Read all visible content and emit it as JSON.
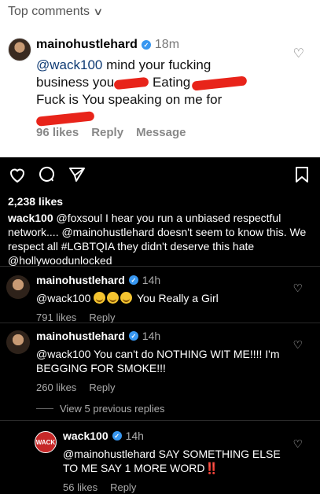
{
  "top_card": {
    "header": "Top comments",
    "username": "mainohustlehard",
    "time": "18m",
    "line1_mention": "@wack100",
    "line1_rest": " mind your fucking",
    "line2_start": "business you",
    "line2_mid": " Eating",
    "line3": "Fuck is You speaking on me for",
    "likes": "96 likes",
    "reply": "Reply",
    "message": "Message"
  },
  "post": {
    "likes": "2,238 likes",
    "caption_user": "wack100",
    "caption_text": " @foxsoul I hear you run a unbiased respectful network.... @mainohustlehard doesn't seem to know this. We respect all #LGBTQIA they didn't deserve this hate @hollywoodunlocked"
  },
  "comments": [
    {
      "username": "mainohustlehard",
      "time": "14h",
      "text_start": "@wack100",
      "text_end": "You Really a Girl",
      "likes": "791 likes",
      "reply": "Reply"
    },
    {
      "username": "mainohustlehard",
      "time": "14h",
      "text": "@wack100 You can't do NOTHING WIT ME!!!! I'm BEGGING FOR SMOKE!!!",
      "likes": "260 likes",
      "reply": "Reply"
    }
  ],
  "view_previous": "View 5 previous replies",
  "reply": {
    "username": "wack100",
    "avatar_text": "WACK",
    "time": "14h",
    "text": "@mainohustlehard SAY SOMETHING ELSE TO ME SAY 1 MORE WORD",
    "bangs": "‼️",
    "likes": "56 likes",
    "reply": "Reply"
  },
  "icons": {
    "heart": "heart-icon",
    "comment": "comment-icon",
    "share": "share-icon",
    "bookmark": "bookmark-icon"
  },
  "colors": {
    "verified": "#3897f0",
    "redaction": "#e8241a",
    "bangs": "#ff2d2d"
  }
}
